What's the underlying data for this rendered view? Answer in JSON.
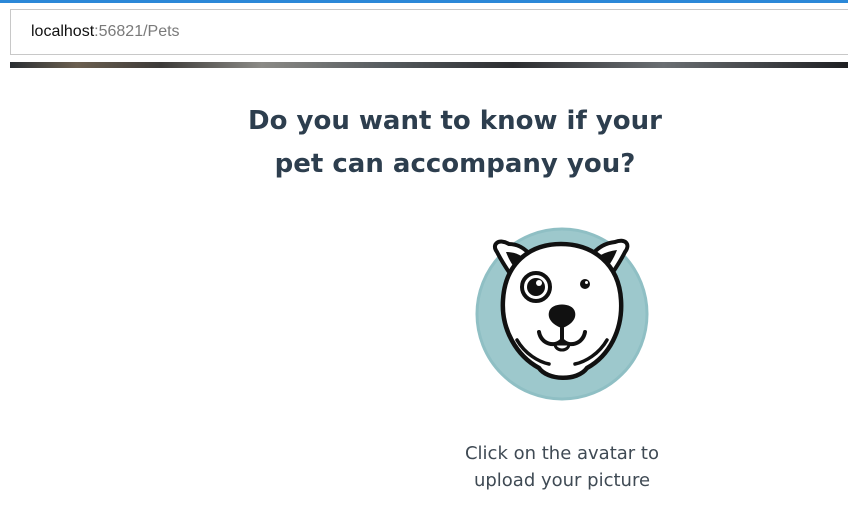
{
  "browser": {
    "url_host": "localhost",
    "url_rest": ":56821/Pets"
  },
  "page": {
    "heading_line1": "Do you want to know if your",
    "heading_line2": "pet can accompany you?",
    "caption_line1": "Click on the avatar to",
    "caption_line2": "upload your picture"
  },
  "avatar": {
    "icon": "dog-avatar-icon",
    "circle_color": "#9dc8cc",
    "face_color": "#ffffff",
    "outline_color": "#111111"
  }
}
